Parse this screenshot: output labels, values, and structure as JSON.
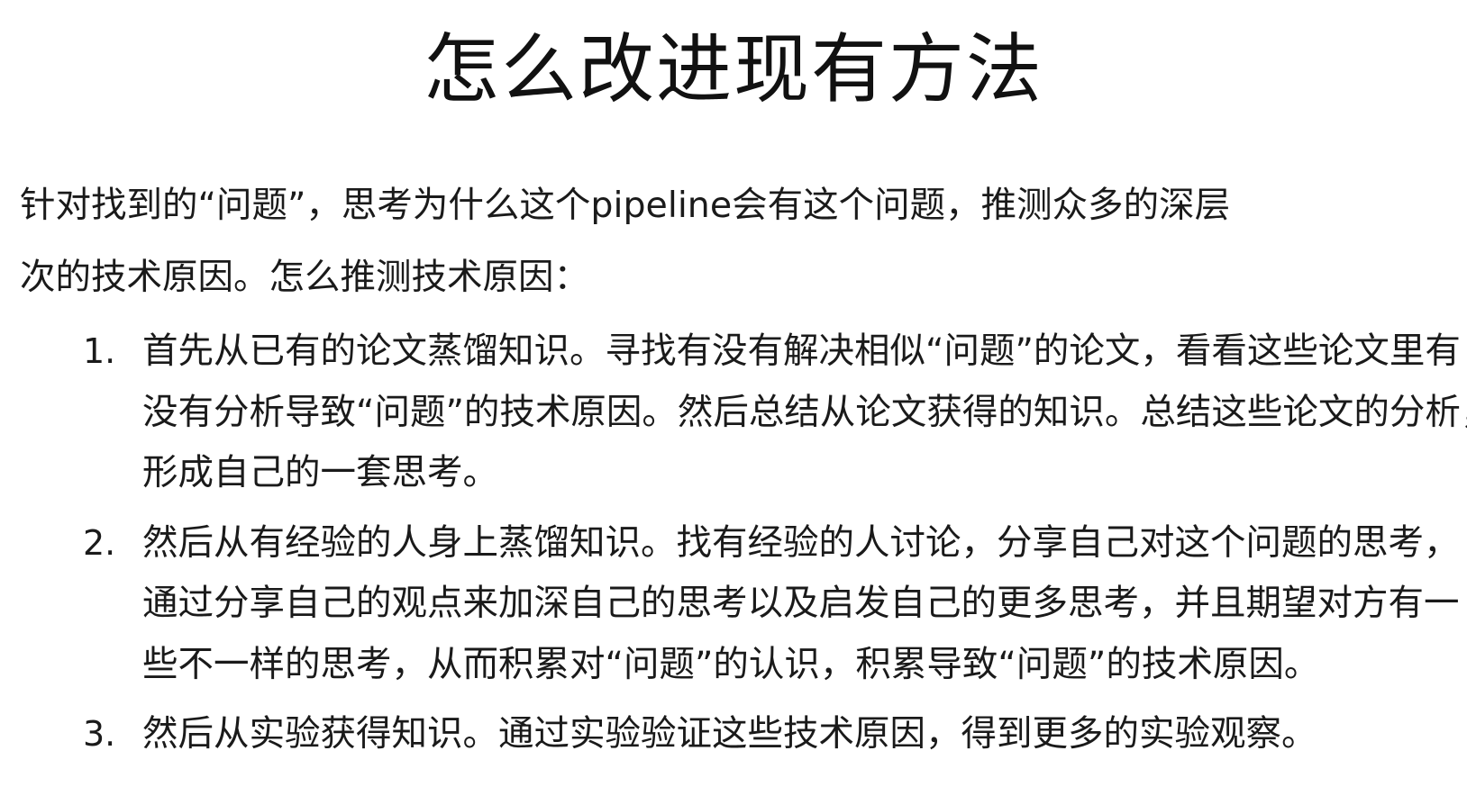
{
  "slide": {
    "title": "怎么改进现有方法",
    "intro_lines": [
      "针对找到的“问题”，思考为什么这个pipeline会有这个问题，推测众多的深层",
      "次的技术原因。怎么推测技术原因："
    ],
    "items": [
      {
        "number": "1.",
        "lines": [
          "首先从已有的论文蒸馏知识。寻找有没有解决相似“问题”的论文，看看这些论文里有",
          "没有分析导致“问题”的技术原因。然后总结从论文获得的知识。总结这些论文的分析，",
          "形成自己的一套思考。"
        ]
      },
      {
        "number": "2.",
        "lines": [
          "然后从有经验的人身上蒸馏知识。找有经验的人讨论，分享自己对这个问题的思考，",
          "通过分享自己的观点来加深自己的思考以及启发自己的更多思考，并且期望对方有一",
          "些不一样的思考，从而积累对“问题”的认识，积累导致“问题”的技术原因。"
        ]
      },
      {
        "number": "3.",
        "lines": [
          "然后从实验获得知识。通过实验验证这些技术原因，得到更多的实验观察。"
        ]
      }
    ]
  }
}
